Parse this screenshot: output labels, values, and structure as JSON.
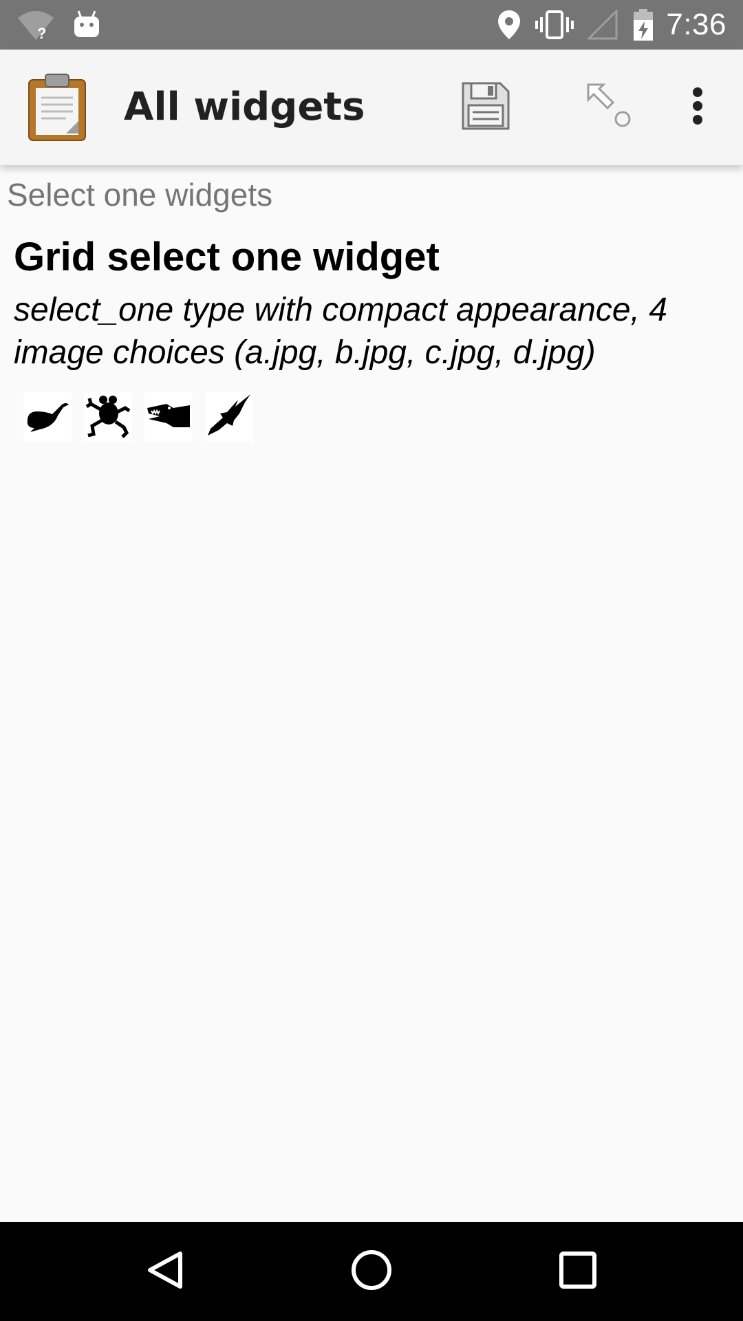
{
  "status_bar": {
    "time": "7:36",
    "icons": [
      "wifi-unknown-icon",
      "android-icon",
      "location-icon",
      "vibrate-icon",
      "signal-icon",
      "battery-charging-icon"
    ]
  },
  "toolbar": {
    "title": "All widgets",
    "icons": [
      "form-clipboard-icon",
      "save-icon",
      "go-to-icon",
      "overflow-menu-icon"
    ]
  },
  "content": {
    "group_label": "Select one widgets",
    "question_label": "Grid select one widget",
    "question_hint": "select_one type with compact appearance, 4 image choices (a.jpg, b.jpg, c.jpg, d.jpg)",
    "choices": [
      {
        "icon": "whale-icon"
      },
      {
        "icon": "frog-icon"
      },
      {
        "icon": "crocodile-icon"
      },
      {
        "icon": "eagle-icon"
      }
    ]
  },
  "nav_bar": {
    "icons": [
      "back-icon",
      "home-icon",
      "recents-icon"
    ]
  }
}
